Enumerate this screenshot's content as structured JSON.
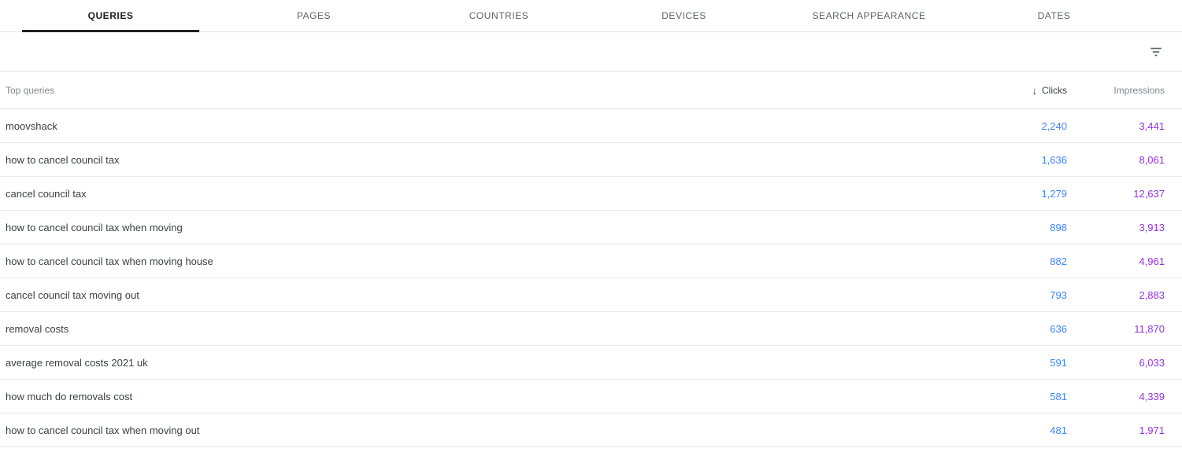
{
  "tabs": [
    {
      "label": "QUERIES",
      "active": true
    },
    {
      "label": "PAGES",
      "active": false
    },
    {
      "label": "COUNTRIES",
      "active": false
    },
    {
      "label": "DEVICES",
      "active": false
    },
    {
      "label": "SEARCH APPEARANCE",
      "active": false
    },
    {
      "label": "DATES",
      "active": false
    }
  ],
  "toolbar": {
    "filter_icon": "filter-list-icon"
  },
  "table": {
    "headers": {
      "query": "Top queries",
      "clicks": "Clicks",
      "impressions": "Impressions",
      "sort_arrow": "↓",
      "sorted_by": "Clicks",
      "sort_direction": "descending"
    },
    "rows": [
      {
        "query": "moovshack",
        "clicks": "2,240",
        "impressions": "3,441"
      },
      {
        "query": "how to cancel council tax",
        "clicks": "1,636",
        "impressions": "8,061"
      },
      {
        "query": "cancel council tax",
        "clicks": "1,279",
        "impressions": "12,637"
      },
      {
        "query": "how to cancel council tax when moving",
        "clicks": "898",
        "impressions": "3,913"
      },
      {
        "query": "how to cancel council tax when moving house",
        "clicks": "882",
        "impressions": "4,961"
      },
      {
        "query": "cancel council tax moving out",
        "clicks": "793",
        "impressions": "2,883"
      },
      {
        "query": "removal costs",
        "clicks": "636",
        "impressions": "11,870"
      },
      {
        "query": "average removal costs 2021 uk",
        "clicks": "591",
        "impressions": "6,033"
      },
      {
        "query": "how much do removals cost",
        "clicks": "581",
        "impressions": "4,339"
      },
      {
        "query": "how to cancel council tax when moving out",
        "clicks": "481",
        "impressions": "1,971"
      }
    ]
  },
  "colors": {
    "clicks": "#4285F4",
    "impressions": "#9334E6",
    "active_tab": "#202124",
    "inactive_tab": "#5F6368",
    "divider": "#E0E0E0"
  }
}
